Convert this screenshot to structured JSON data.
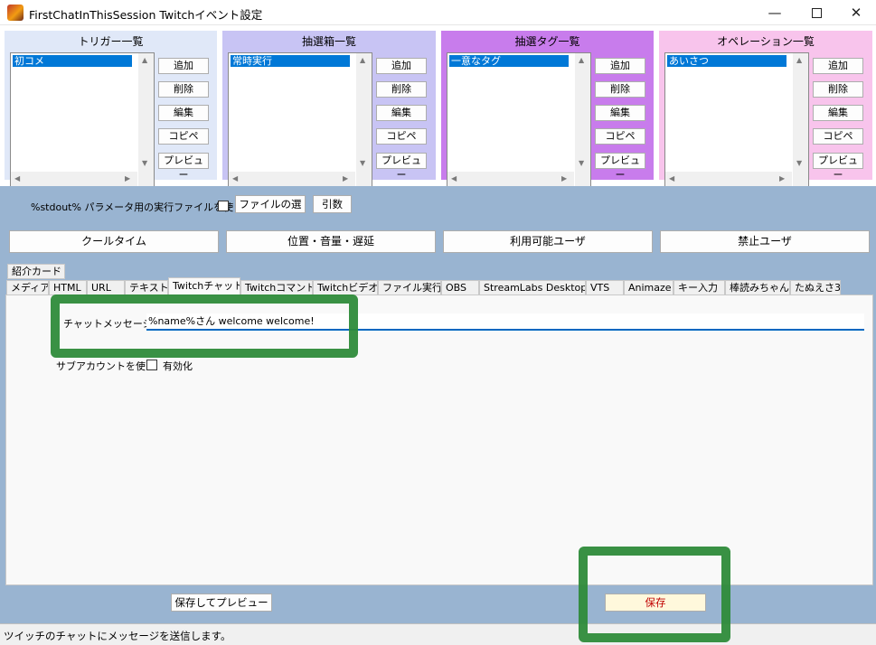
{
  "window": {
    "title": "FirstChatInThisSession Twitchイベント設定",
    "controls": {
      "minimize": "—",
      "close": "✕"
    }
  },
  "panels": [
    {
      "title": "トリガー一覧",
      "selected_item": "初コメ",
      "color": "#e0e8f8"
    },
    {
      "title": "抽選箱一覧",
      "selected_item": "常時実行",
      "color": "#c8c4f4"
    },
    {
      "title": "抽選タグ一覧",
      "selected_item": "一意なタグ",
      "color": "#c87cec"
    },
    {
      "title": "オペレーション一覧",
      "selected_item": "あいさつ",
      "color": "#f8c4ec"
    }
  ],
  "panel_buttons": [
    "追加",
    "削除",
    "編集",
    "コピペ",
    "プレビュー"
  ],
  "stdout": {
    "label": "%stdout% パラメータ用の実行ファイルを使う",
    "file_button": "ファイルの選",
    "args_button": "引数"
  },
  "wide_buttons": [
    "クールタイム",
    "位置・音量・遅延",
    "利用可能ユーザ",
    "禁止ユーザ"
  ],
  "tabs_row1": [
    "紹介カード"
  ],
  "tabs_row2": [
    "メディア",
    "HTML",
    "URL",
    "テキスト",
    "Twitchチャット",
    "Twitchコマンド",
    "Twitchビデオ",
    "ファイル実行",
    "OBS",
    "StreamLabs Desktop",
    "VTS",
    "Animaze",
    "キー入力",
    "棒読みちゃん",
    "たぬえさ3"
  ],
  "active_tab": "Twitchチャット",
  "chat": {
    "label": "チャットメッセージ",
    "value": "%name%さん  welcome welcome!",
    "subaccount_label": "サブアカウントを使う",
    "subaccount_checkbox_label": "有効化"
  },
  "bottom_buttons": {
    "preview_save": "保存してプレビュー",
    "save": "保存"
  },
  "status": "ツイッチのチャットにメッセージを送信します。",
  "colors": {
    "mid_bg": "#99b4d1",
    "marker": "#2e8b3a",
    "selection": "#0078d7",
    "save_text": "#c00000"
  }
}
